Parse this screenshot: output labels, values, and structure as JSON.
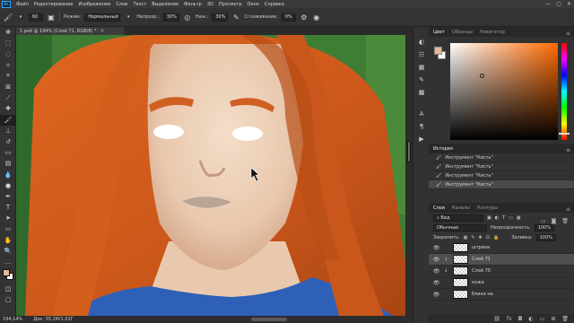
{
  "menubar": {
    "logo": "Ps",
    "items": [
      "Файл",
      "Редактирование",
      "Изображение",
      "Слои",
      "Текст",
      "Выделение",
      "Фильтр",
      "3D",
      "Просмотр",
      "Окно",
      "Справка"
    ],
    "window_controls": [
      "—",
      "▢",
      "✕"
    ]
  },
  "options": {
    "mode_label": "Режим:",
    "mode_value": "Нормальный",
    "opacity_label": "Непрозр.:",
    "opacity_value": "30%",
    "pressure_label": "Наж.:",
    "pressure_value": "30%",
    "smoothing_label": "Сглаживание:",
    "smoothing_value": "0%",
    "brush_size": "60"
  },
  "document": {
    "tab_title": "1.psd @ 194% (Слой 71, RGB/8) *",
    "close": "×"
  },
  "status": {
    "zoom": "194,14%",
    "doc_info": "Док: 35,1M/1,02Г"
  },
  "colors": {
    "foreground": "#e8b898",
    "background": "#ffffff",
    "accent": "#31a8ff"
  },
  "color_panel": {
    "tabs": [
      "Цвет",
      "Образцы",
      "Навигатор"
    ],
    "active_tab": 0
  },
  "history_panel": {
    "title": "История",
    "items": [
      "Инструмент \"Кисть\"",
      "Инструмент \"Кисть\"",
      "Инструмент \"Кисть\"",
      "Инструмент \"Кисть\""
    ],
    "selected_index": 3
  },
  "layers_panel": {
    "tabs": [
      "Слои",
      "Каналы",
      "Контуры"
    ],
    "active_tab": 0,
    "filter_label": "Вид",
    "blend_mode": "Обычные",
    "opacity_label": "Непрозрачность:",
    "opacity_value": "100%",
    "lock_label": "Закрепить:",
    "fill_label": "Заливка:",
    "fill_value": "100%",
    "layers": [
      {
        "name": "штрихи",
        "visible": true,
        "clipped": false
      },
      {
        "name": "Слой 71",
        "visible": true,
        "clipped": true
      },
      {
        "name": "Слой 70",
        "visible": true,
        "clipped": true
      },
      {
        "name": "кожа",
        "visible": true,
        "clipped": false
      },
      {
        "name": "блики на",
        "visible": true,
        "clipped": false
      }
    ],
    "selected_index": 1
  }
}
